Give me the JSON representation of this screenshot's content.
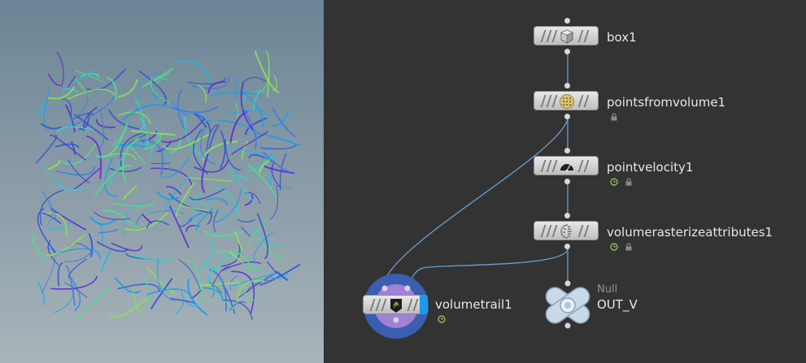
{
  "viewport": {
    "curve_colors": [
      "#2a52d6",
      "#3f7de0",
      "#27b5e0",
      "#33d0c8",
      "#4ae08e",
      "#3557c9",
      "#5e2ed1",
      "#1e9ee8",
      "#8be05a"
    ]
  },
  "network": {
    "wire_color": "#6a9fd6",
    "nodes": [
      {
        "id": "box1",
        "label": "box1",
        "icon": "cube-icon",
        "flags": []
      },
      {
        "id": "pointsfromvolume1",
        "label": "pointsfromvolume1",
        "icon": "points-grid-icon",
        "flags": [
          "lock-icon"
        ]
      },
      {
        "id": "pointvelocity1",
        "label": "pointvelocity1",
        "icon": "speedometer-icon",
        "flags": [
          "time-dependent-icon",
          "lock-icon"
        ]
      },
      {
        "id": "volumerasterizeattributes1",
        "label": "volumerasterizeattributes1",
        "icon": "rasterize-icon",
        "flags": [
          "time-dependent-icon",
          "lock-icon"
        ]
      },
      {
        "id": "volumetrail1",
        "label": "volumetrail1",
        "icon": "volume-trail-icon",
        "flags": [
          "time-dependent-icon"
        ],
        "display_flag_color": "#1e9be8",
        "ring_color": "#3a5fb0"
      },
      {
        "id": "out_v",
        "label": "OUT_V",
        "type_label": "Null",
        "icon": "null-icon",
        "flags": []
      }
    ]
  }
}
